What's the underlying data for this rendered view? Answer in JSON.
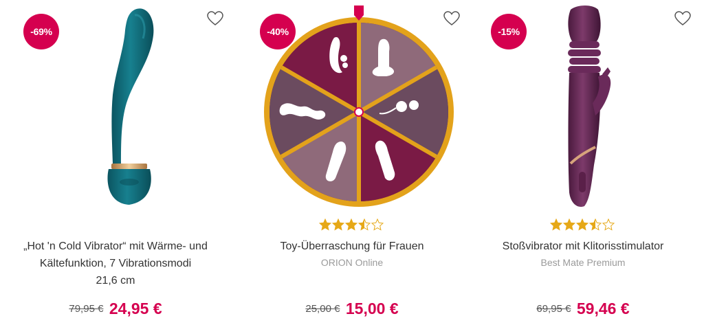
{
  "products": [
    {
      "discount_badge": "-69%",
      "title_line1": "„Hot 'n Cold Vibrator“ mit Wärme- und",
      "title_line2": "Kältefunktion, 7 Vibrationsmodi",
      "title_line3": "21,6 cm",
      "old_price": "79,95 €",
      "new_price": "24,95 €",
      "image_icon": "teal-g-spot-vibrator-image",
      "wishlist_icon": "heart-outline-icon"
    },
    {
      "discount_badge": "-40%",
      "rating": 3.5,
      "rating_max": 5,
      "title": "Toy-Überraschung für Frauen",
      "brand": "ORION Online",
      "old_price": "25,00 €",
      "new_price": "15,00 €",
      "image_icon": "surprise-wheel-image",
      "wishlist_icon": "heart-outline-icon"
    },
    {
      "discount_badge": "-15%",
      "rating": 3.5,
      "rating_max": 5,
      "title": "Stoßvibrator mit Klitorisstimulator",
      "brand": "Best Mate Premium",
      "old_price": "69,95 €",
      "new_price": "59,46 €",
      "image_icon": "purple-rabbit-thrusting-vibrator-image",
      "wishlist_icon": "heart-outline-icon"
    }
  ],
  "colors": {
    "badge": "#d5004f",
    "price": "#d5004f",
    "star": "#e6a817",
    "brand_text": "#9a9a9a"
  }
}
